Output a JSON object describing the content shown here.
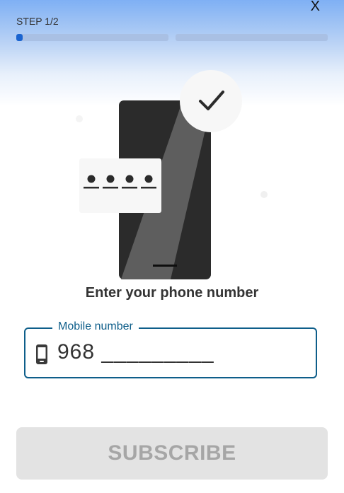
{
  "header": {
    "close_label": "X",
    "step_label": "STEP 1/2",
    "progress": [
      {
        "fill_fraction": 0.04
      },
      {
        "fill_fraction": 0
      }
    ]
  },
  "illustration": {
    "icon": "phone-with-password-and-checkmark",
    "pin_dots": 4
  },
  "headline": "Enter your phone number",
  "mobile_field": {
    "label": "Mobile number",
    "icon": "mobile-phone-icon",
    "prefix": "968",
    "mask": "_________"
  },
  "subscribe_button": {
    "label": "SUBSCRIBE",
    "state": "disabled"
  },
  "colors": {
    "accent": "#0e5e8a",
    "progress_fill": "#1a64d0",
    "button_bg": "#e3e3e3",
    "button_text": "#a6a6a6"
  }
}
